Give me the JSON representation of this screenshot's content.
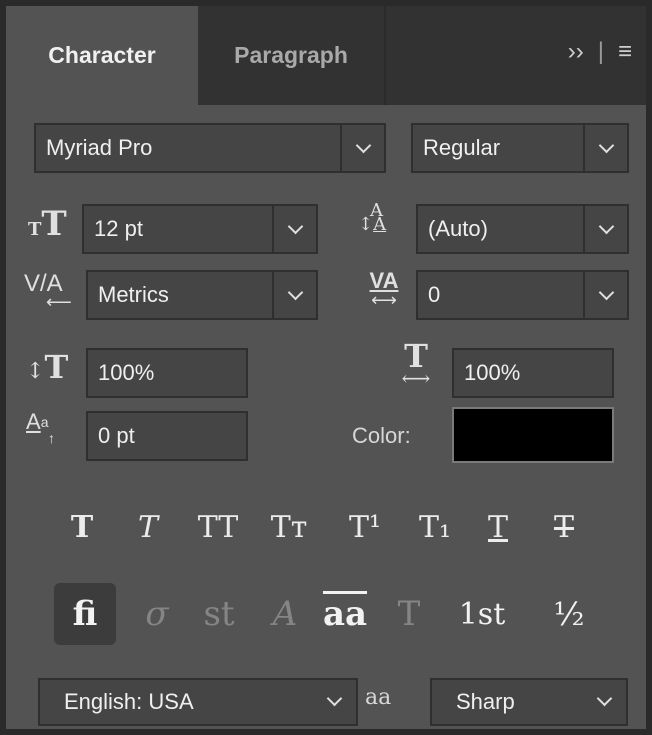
{
  "tabs": {
    "character": "Character",
    "paragraph": "Paragraph"
  },
  "header_icons": {
    "expand": "››",
    "separator": "|",
    "menu": "≡"
  },
  "font": {
    "family": "Myriad Pro",
    "style": "Regular"
  },
  "size": {
    "value": "12 pt",
    "icon": "font-size-icon"
  },
  "leading": {
    "value": "(Auto)",
    "icon": "leading-icon"
  },
  "kerning": {
    "icon_text": "V/A",
    "value": "Metrics"
  },
  "tracking": {
    "icon_text": "VA",
    "value": "0"
  },
  "vertical_scale": {
    "value": "100%"
  },
  "horizontal_scale": {
    "value": "100%"
  },
  "baseline_shift": {
    "value": "0 pt"
  },
  "color": {
    "label": "Color:",
    "swatch": "#000000"
  },
  "type_styles": [
    "T",
    "T",
    "TT",
    "Tт",
    "T¹",
    "T₁",
    "T",
    "T"
  ],
  "opentype": [
    "ﬁ",
    "σ",
    "st",
    "A",
    "aa",
    "T",
    "1st",
    "½"
  ],
  "language": {
    "value": "English: USA"
  },
  "aa_icon": "aa",
  "antialias": {
    "value": "Sharp"
  }
}
